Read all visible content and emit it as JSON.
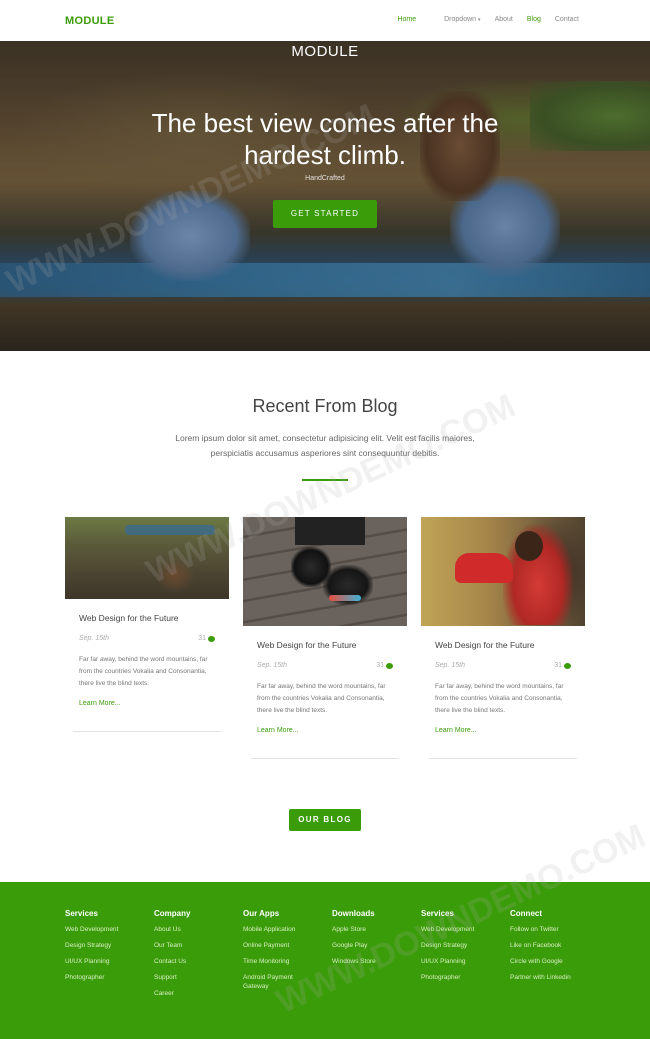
{
  "nav": {
    "brand": "MODULE",
    "items": [
      {
        "label": "Home",
        "active": true
      },
      {
        "label": "Dropdown",
        "caret": "▾",
        "active": false
      },
      {
        "label": "About",
        "active": false
      },
      {
        "label": "Blog",
        "active": true
      },
      {
        "label": "Contact",
        "active": false
      }
    ]
  },
  "hero": {
    "title": "MODULE",
    "heading_line1": "The best view comes after the",
    "heading_line2": "hardest climb.",
    "subheading": "HandCrafted",
    "button": "GET STARTED"
  },
  "blog": {
    "title": "Recent From Blog",
    "intro": "Lorem ipsum dolor sit amet, consectetur adipisicing elit. Velit est facilis maiores, perspiciatis accusamus asperiores sint consequuntur debitis.",
    "cards": [
      {
        "title": "Web Design for the Future",
        "date": "Sep. 15th",
        "comments": "31",
        "text": "Far far away, behind the word mountains, far from the countries Vokalia and Consonantia, there live the blind texts.",
        "link": "Learn More..."
      },
      {
        "title": "Web Design for the Future",
        "date": "Sep. 15th",
        "comments": "31",
        "text": "Far far away, behind the word mountains, far from the countries Vokalia and Consonantia, there live the blind texts.",
        "link": "Learn More..."
      },
      {
        "title": "Web Design for the Future",
        "date": "Sep. 15th",
        "comments": "31",
        "text": "Far far away, behind the word mountains, far from the countries Vokalia and Consonantia, there live the blind texts.",
        "link": "Learn More..."
      }
    ],
    "button": "OUR BLOG"
  },
  "footer": {
    "columns": [
      {
        "heading": "Services",
        "links": [
          "Web Development",
          "Design Strategy",
          "UI/UX Planning",
          "Photographer"
        ]
      },
      {
        "heading": "Company",
        "links": [
          "About Us",
          "Our Team",
          "Contact Us",
          "Support",
          "Career"
        ]
      },
      {
        "heading": "Our Apps",
        "links": [
          "Mobile Application",
          "Online Payment",
          "Time Monitoring",
          "Android Payment Gateway"
        ]
      },
      {
        "heading": "Downloads",
        "links": [
          "Apple Store",
          "Google Play",
          "Windows Store"
        ]
      },
      {
        "heading": "Services",
        "links": [
          "Web Development",
          "Design Strategy",
          "UI/UX Planning",
          "Photographer"
        ]
      },
      {
        "heading": "Connect",
        "links": [
          "Follow on Twitter",
          "Like on Facebook",
          "Circle with Google",
          "Partner with Linkedin"
        ]
      }
    ]
  },
  "watermark": "WWW.DOWNDEMO.COM",
  "colors": {
    "accent": "#3a9c08",
    "footer_bg": "#3a9c08"
  }
}
